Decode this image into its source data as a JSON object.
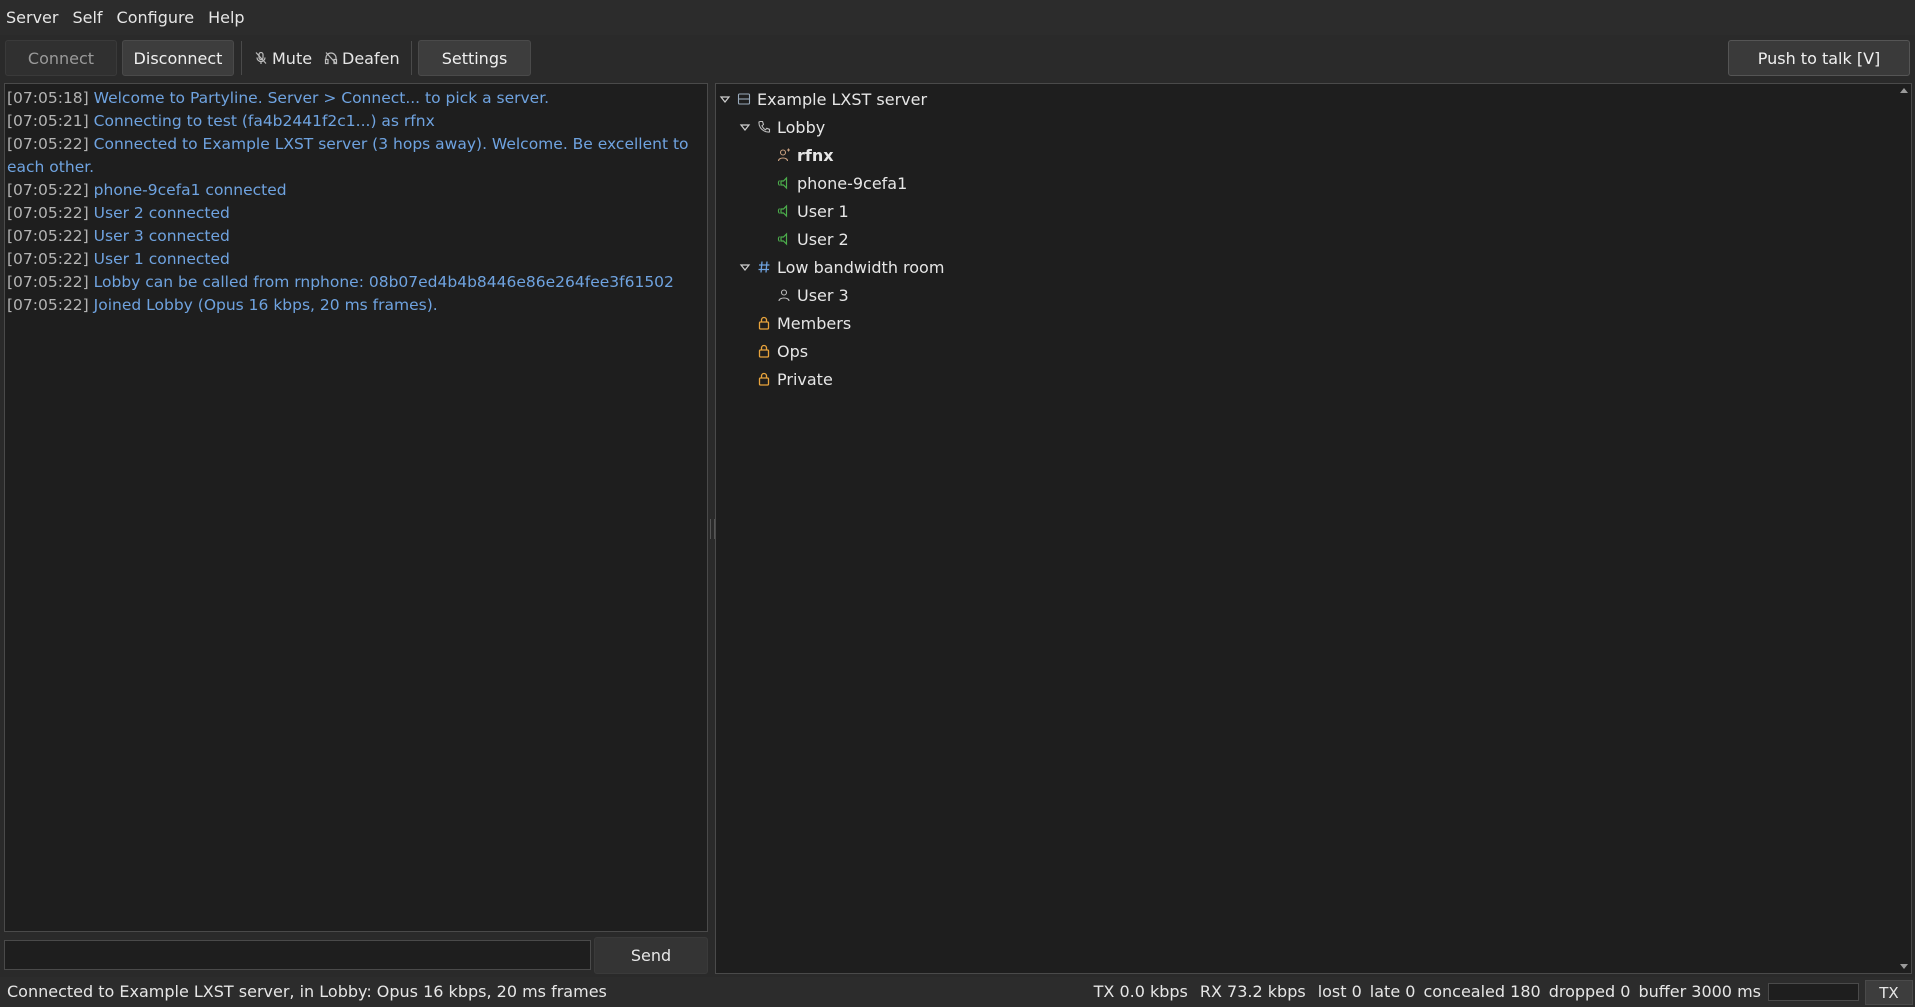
{
  "menu": [
    "Server",
    "Self",
    "Configure",
    "Help"
  ],
  "toolbar": {
    "connect": "Connect",
    "disconnect": "Disconnect",
    "mute": "Mute",
    "deafen": "Deafen",
    "settings": "Settings",
    "push_to_talk": "Push to talk  [V]"
  },
  "log": [
    {
      "ts": "[07:05:18]",
      "text": "Welcome to Partyline. Server > Connect... to pick a server."
    },
    {
      "ts": "[07:05:21]",
      "text": "Connecting to test (fa4b2441f2c1...) as rfnx"
    },
    {
      "ts": "[07:05:22]",
      "text": "Connected to Example LXST server (3 hops away). Welcome. Be excellent to each other."
    },
    {
      "ts": "[07:05:22]",
      "text": "phone-9cefa1 connected"
    },
    {
      "ts": "[07:05:22]",
      "text": "User 2 connected"
    },
    {
      "ts": "[07:05:22]",
      "text": "User 3 connected"
    },
    {
      "ts": "[07:05:22]",
      "text": "User 1 connected"
    },
    {
      "ts": "[07:05:22]",
      "text": "Lobby can be called from rnphone: 08b07ed4b4b8446e86e264fee3f61502"
    },
    {
      "ts": "[07:05:22]",
      "text": "Joined Lobby (Opus 16 kbps, 20 ms frames)."
    }
  ],
  "tree": {
    "server": "Example LXST server",
    "lobby": {
      "name": "Lobby",
      "users": [
        {
          "name": "rfnx",
          "self": true
        },
        {
          "name": "phone-9cefa1",
          "speaking": true
        },
        {
          "name": "User 1",
          "speaking": true
        },
        {
          "name": "User 2",
          "speaking": true
        }
      ]
    },
    "low_bw": {
      "name": "Low bandwidth room",
      "users": [
        {
          "name": "User 3"
        }
      ]
    },
    "locked": [
      "Members",
      "Ops",
      "Private"
    ]
  },
  "input": {
    "placeholder": "",
    "send": "Send"
  },
  "status": {
    "left": "Connected to Example LXST server, in Lobby: Opus 16 kbps, 20 ms frames",
    "tx": "TX  0.0 kbps",
    "rx": "RX 73.2 kbps",
    "lost": "lost 0",
    "late": "late 0",
    "concealed": "concealed 180",
    "dropped": "dropped 0",
    "buffer": "buffer 3000 ms",
    "tx_badge": "TX",
    "level": 0
  },
  "colors": {
    "log_text": "#6fa3e0",
    "speaking": "#4cae4c",
    "lock": "#e8a33c"
  }
}
